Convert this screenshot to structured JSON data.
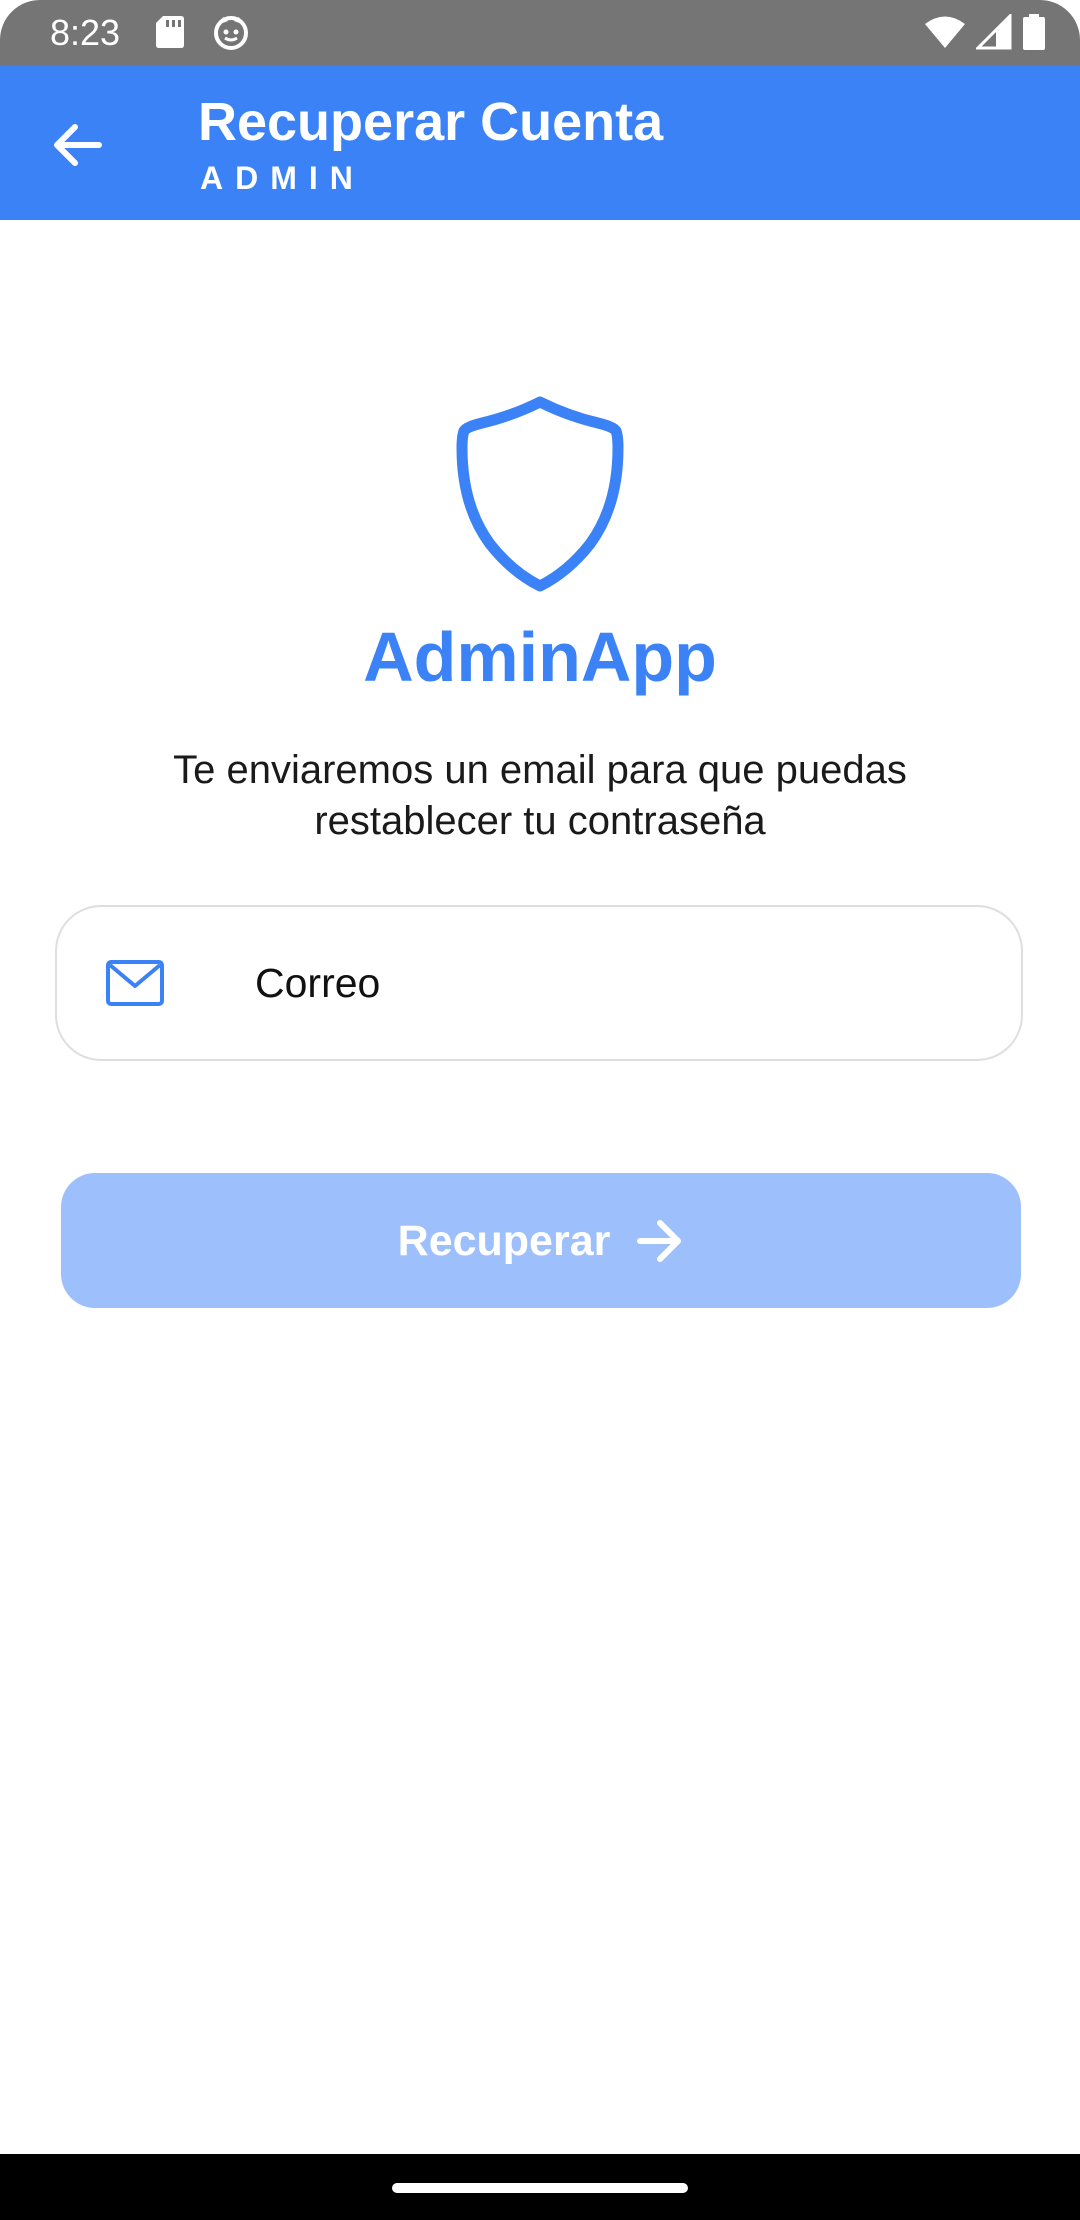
{
  "status_bar": {
    "time": "8:23",
    "icons": [
      "sd-card-icon",
      "cat-face-icon",
      "wifi-icon",
      "signal-icon",
      "battery-icon"
    ]
  },
  "app_bar": {
    "title": "Recuperar Cuenta",
    "subtitle": "ADMIN",
    "back_icon": "arrow-back-icon",
    "background_color": "#3b82f6"
  },
  "logo": {
    "icon": "shield-icon",
    "brand_name": "AdminApp",
    "color": "#3b82f6"
  },
  "description": "Te enviaremos un email para que puedas restablecer tu contraseña",
  "email_field": {
    "icon": "mail-icon",
    "placeholder": "Correo",
    "value": ""
  },
  "submit_button": {
    "label": "Recuperar",
    "icon": "arrow-right-icon",
    "color": "#9dbffc",
    "enabled": false
  }
}
